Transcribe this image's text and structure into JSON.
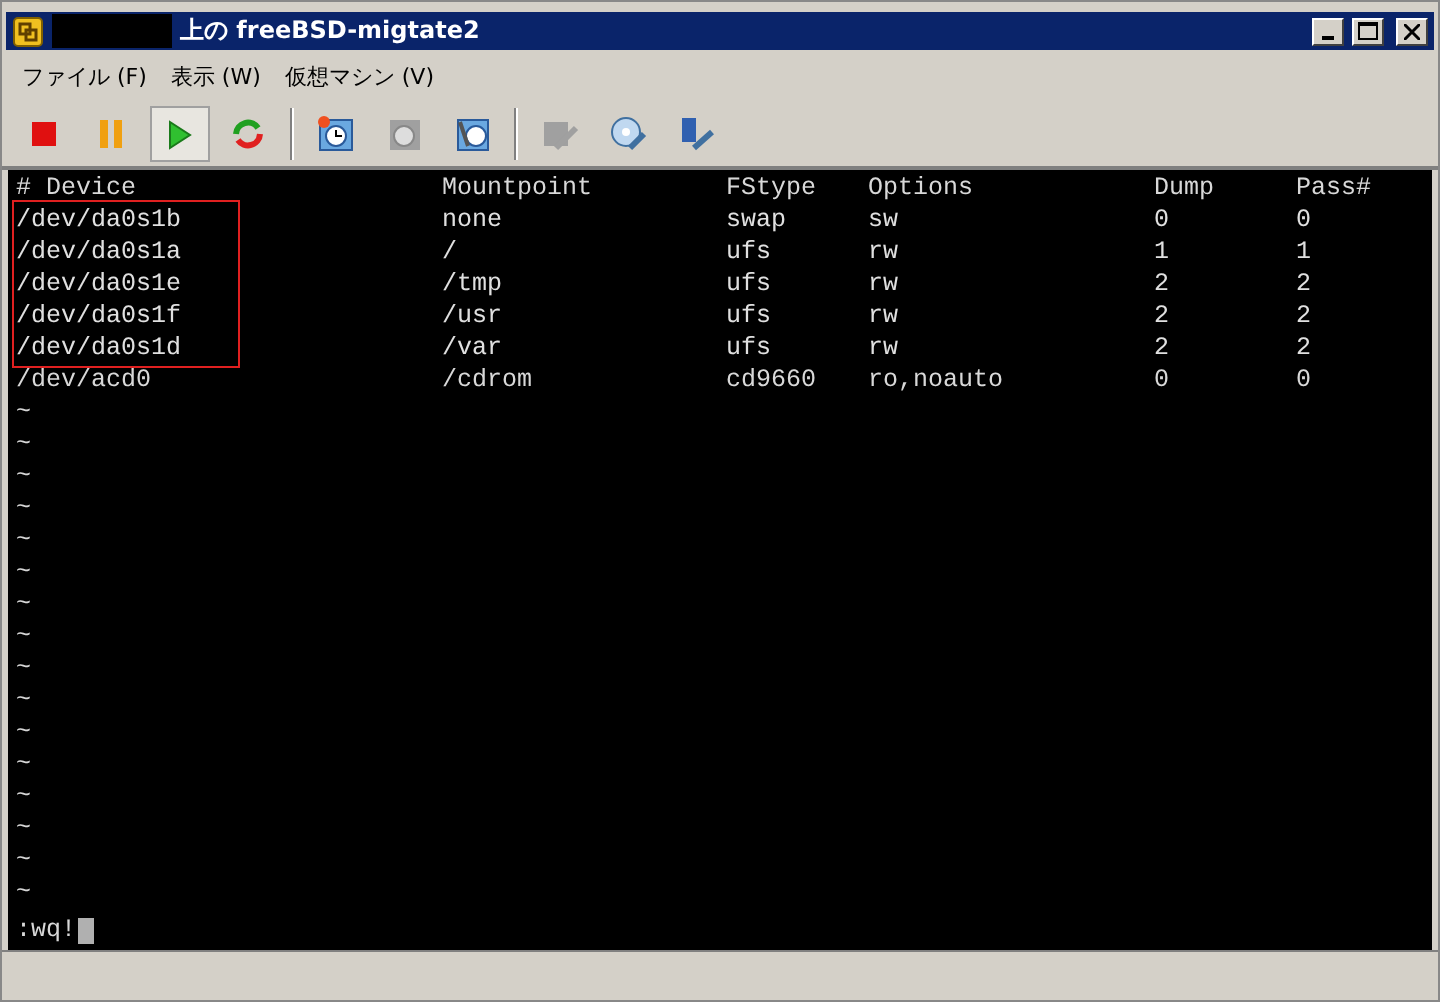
{
  "window": {
    "title": "上の freeBSD-migtate2",
    "redacted_prefix": true
  },
  "menu": [
    {
      "label": "ファイル (F)"
    },
    {
      "label": "表示 (W)"
    },
    {
      "label": "仮想マシン (V)"
    }
  ],
  "toolbar": [
    {
      "kind": "stop",
      "selected": false,
      "disabled": false
    },
    {
      "kind": "pause",
      "selected": false,
      "disabled": false
    },
    {
      "kind": "play",
      "selected": true,
      "disabled": false
    },
    {
      "kind": "reset",
      "selected": false,
      "disabled": false
    },
    {
      "kind": "separator"
    },
    {
      "kind": "snapshot",
      "selected": false,
      "disabled": false
    },
    {
      "kind": "revert",
      "selected": false,
      "disabled": true
    },
    {
      "kind": "manage",
      "selected": false,
      "disabled": false
    },
    {
      "kind": "separator"
    },
    {
      "kind": "floppy",
      "selected": false,
      "disabled": true
    },
    {
      "kind": "cd",
      "selected": false,
      "disabled": false
    },
    {
      "kind": "usb",
      "selected": false,
      "disabled": false
    }
  ],
  "terminal": {
    "columns": [
      "# Device",
      "Mountpoint",
      "FStype",
      "Options",
      "Dump",
      "Pass#"
    ],
    "rows": [
      {
        "cells": [
          "/dev/da0s1b",
          "none",
          "swap",
          "sw",
          "0",
          "0"
        ],
        "highlighted": true
      },
      {
        "cells": [
          "/dev/da0s1a",
          "/",
          "ufs",
          "rw",
          "1",
          "1"
        ],
        "highlighted": true
      },
      {
        "cells": [
          "/dev/da0s1e",
          "/tmp",
          "ufs",
          "rw",
          "2",
          "2"
        ],
        "highlighted": true
      },
      {
        "cells": [
          "/dev/da0s1f",
          "/usr",
          "ufs",
          "rw",
          "2",
          "2"
        ],
        "highlighted": true
      },
      {
        "cells": [
          "/dev/da0s1d",
          "/var",
          "ufs",
          "rw",
          "2",
          "2"
        ],
        "highlighted": true
      },
      {
        "cells": [
          "/dev/acd0",
          "/cdrom",
          "cd9660",
          "ro,noauto",
          "0",
          "0"
        ],
        "highlighted": false
      }
    ],
    "empty_lines": [
      "~",
      "~",
      "~",
      "~",
      "~",
      "~",
      "~",
      "~",
      "~",
      "~",
      "~",
      "~",
      "~",
      "~",
      "~",
      "~"
    ],
    "command": ":wq!",
    "cursor": true
  }
}
